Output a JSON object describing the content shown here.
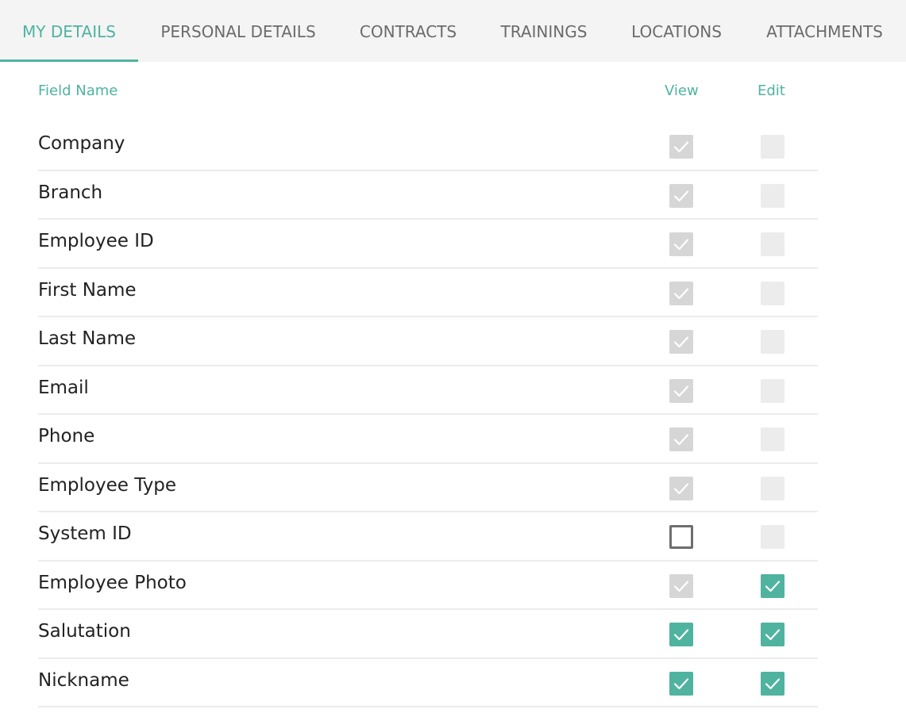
{
  "tabs": [
    {
      "label": "MY DETAILS",
      "active": true
    },
    {
      "label": "PERSONAL DETAILS",
      "active": false
    },
    {
      "label": "CONTRACTS",
      "active": false
    },
    {
      "label": "TRAININGS",
      "active": false
    },
    {
      "label": "LOCATIONS",
      "active": false
    },
    {
      "label": "ATTACHMENTS",
      "active": false
    }
  ],
  "table": {
    "headers": {
      "field_name": "Field Name",
      "view": "View",
      "edit": "Edit"
    },
    "rows": [
      {
        "label": "Company",
        "view": "disabled-checked",
        "edit": "disabled-unchecked"
      },
      {
        "label": "Branch",
        "view": "disabled-checked",
        "edit": "disabled-unchecked"
      },
      {
        "label": "Employee ID",
        "view": "disabled-checked",
        "edit": "disabled-unchecked"
      },
      {
        "label": "First Name",
        "view": "disabled-checked",
        "edit": "disabled-unchecked"
      },
      {
        "label": "Last Name",
        "view": "disabled-checked",
        "edit": "disabled-unchecked"
      },
      {
        "label": "Email",
        "view": "disabled-checked",
        "edit": "disabled-unchecked"
      },
      {
        "label": "Phone",
        "view": "disabled-checked",
        "edit": "disabled-unchecked"
      },
      {
        "label": "Employee Type",
        "view": "disabled-checked",
        "edit": "disabled-unchecked"
      },
      {
        "label": "System ID",
        "view": "unchecked",
        "edit": "disabled-unchecked"
      },
      {
        "label": "Employee Photo",
        "view": "disabled-checked",
        "edit": "checked"
      },
      {
        "label": "Salutation",
        "view": "checked",
        "edit": "checked"
      },
      {
        "label": "Nickname",
        "view": "checked",
        "edit": "checked"
      }
    ]
  },
  "colors": {
    "accent": "#4fb3a0",
    "tab_bar_bg": "#f4f4f4",
    "tab_text": "#6b6b6b",
    "disabled_checked": "#d6d6d6",
    "disabled_unchecked": "#ececec"
  }
}
